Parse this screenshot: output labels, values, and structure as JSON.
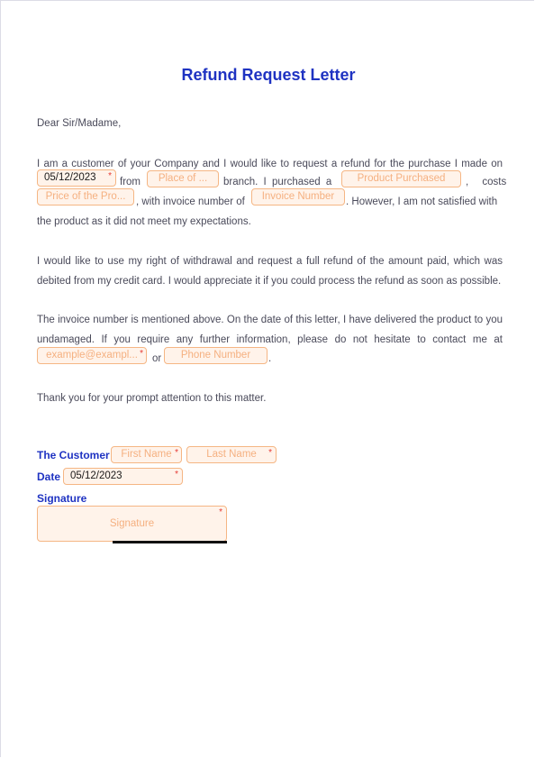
{
  "document": {
    "title": "Refund Request Letter",
    "greeting": "Dear Sir/Madame,",
    "para1": {
      "line1": "I am a customer of your Company and I would like to request a refund for the purchase I made on",
      "purchase_date": "05/12/2023",
      "from_text": "from",
      "place_placeholder": "Place of ...",
      "branch_text": "branch. I purchased a",
      "product_placeholder": "Product Purchased",
      "costs_text": ", costs",
      "price_placeholder": "Price of the Pro...",
      "invoice_text": ", with invoice number of",
      "invoice_placeholder": "Invoice Number",
      "however_text": ". However, I am not satisfied with",
      "last_line": "the product as it did not meet my expectations."
    },
    "para2": "I would like to use my right of withdrawal and request a full refund of the amount paid, which was debited from my credit card. I would appreciate it if you could process the refund as soon as possible.",
    "para3": {
      "text": "The invoice number is mentioned above. On the date of this letter, I have delivered the product to you undamaged. If you require any further information, please do not hesitate to contact me at",
      "email_placeholder": "example@exampl...",
      "or_text": "or",
      "phone_placeholder": "Phone Number",
      "period": "."
    },
    "closing": "Thank you for your prompt attention to this matter.",
    "signature_block": {
      "customer_label": "The Customer",
      "first_name_placeholder": "First Name",
      "last_name_placeholder": "Last Name",
      "date_label": "Date",
      "date_value": "05/12/2023",
      "signature_label": "Signature",
      "signature_placeholder": "Signature"
    },
    "required_mark": "*"
  },
  "colors": {
    "accent": "#1f33c2",
    "field_border": "#f5b684",
    "field_bg": "#fff3ea",
    "placeholder": "#f5b080",
    "required": "#e53935",
    "body_text": "#4a4a5a"
  }
}
